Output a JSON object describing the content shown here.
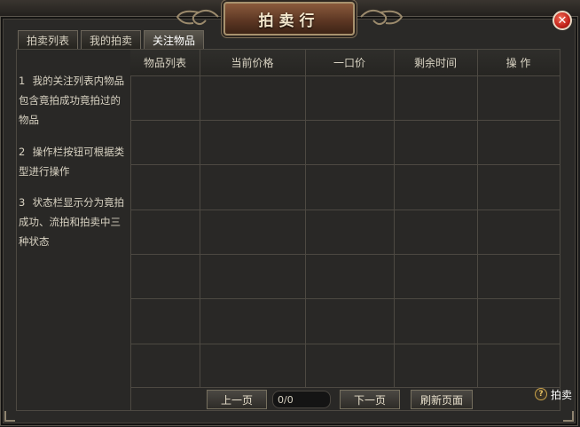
{
  "window": {
    "title": "拍卖行",
    "close_symbol": "✕"
  },
  "tabs": [
    {
      "label": "拍卖列表",
      "active": false
    },
    {
      "label": "我的拍卖",
      "active": false
    },
    {
      "label": "关注物品",
      "active": true
    }
  ],
  "notes": [
    {
      "num": "1",
      "text": "我的关注列表内物品包含竟拍成功竟拍过的物品"
    },
    {
      "num": "2",
      "text": "操作栏按钮可根据类型进行操作"
    },
    {
      "num": "3",
      "text": "状态栏显示分为竟拍成功、流拍和拍卖中三种状态"
    }
  ],
  "table": {
    "headers": [
      "物品列表",
      "当前价格",
      "一口价",
      "剩余时间",
      "操 作"
    ],
    "rows": 6
  },
  "footer": {
    "prev_label": "上一页",
    "page_value": "0/0",
    "next_label": "下一页",
    "refresh_label": "刷新页面"
  },
  "help": {
    "icon_symbol": "?",
    "label": "拍卖"
  },
  "colors": {
    "panel_bg": "#2a2927",
    "grid_line": "#4d4942",
    "title_plate": "#5a3522",
    "close_red": "#c2231a"
  }
}
